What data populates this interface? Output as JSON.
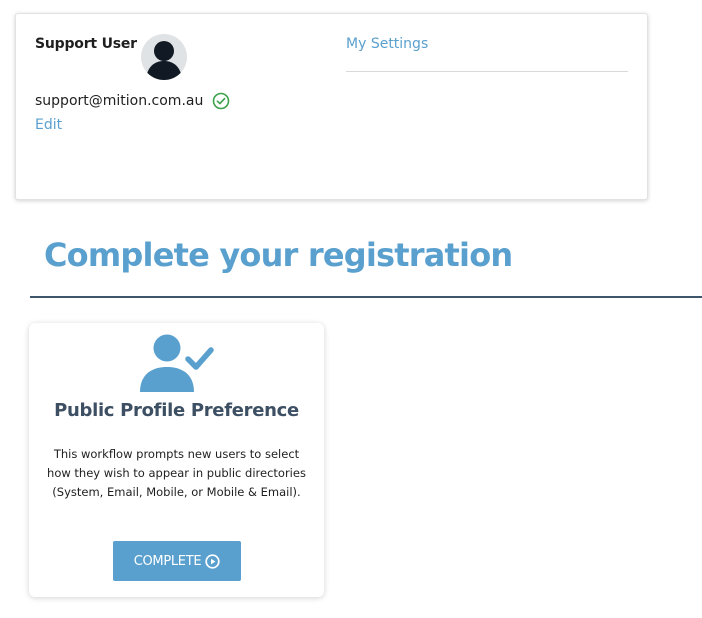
{
  "profile": {
    "name": "Support User",
    "email": "support@mition.com.au",
    "edit_label": "Edit",
    "settings_label": "My Settings",
    "avatar_icon": "user-avatar-icon",
    "verified_icon": "check-circle-icon"
  },
  "registration": {
    "title": "Complete your registration",
    "workflow": {
      "icon": "user-check-icon",
      "title": "Public Profile Preference",
      "description": "This workflow prompts new users to select how they wish to appear in public directories (System, Email, Mobile, or Mobile & Email).",
      "button_label": "COMPLETE",
      "button_icon": "play-circle-icon"
    }
  },
  "colors": {
    "accent": "#5aa0cf",
    "heading_dark": "#3d4f63",
    "rule": "#3d566e",
    "verified": "#3aa24a"
  }
}
